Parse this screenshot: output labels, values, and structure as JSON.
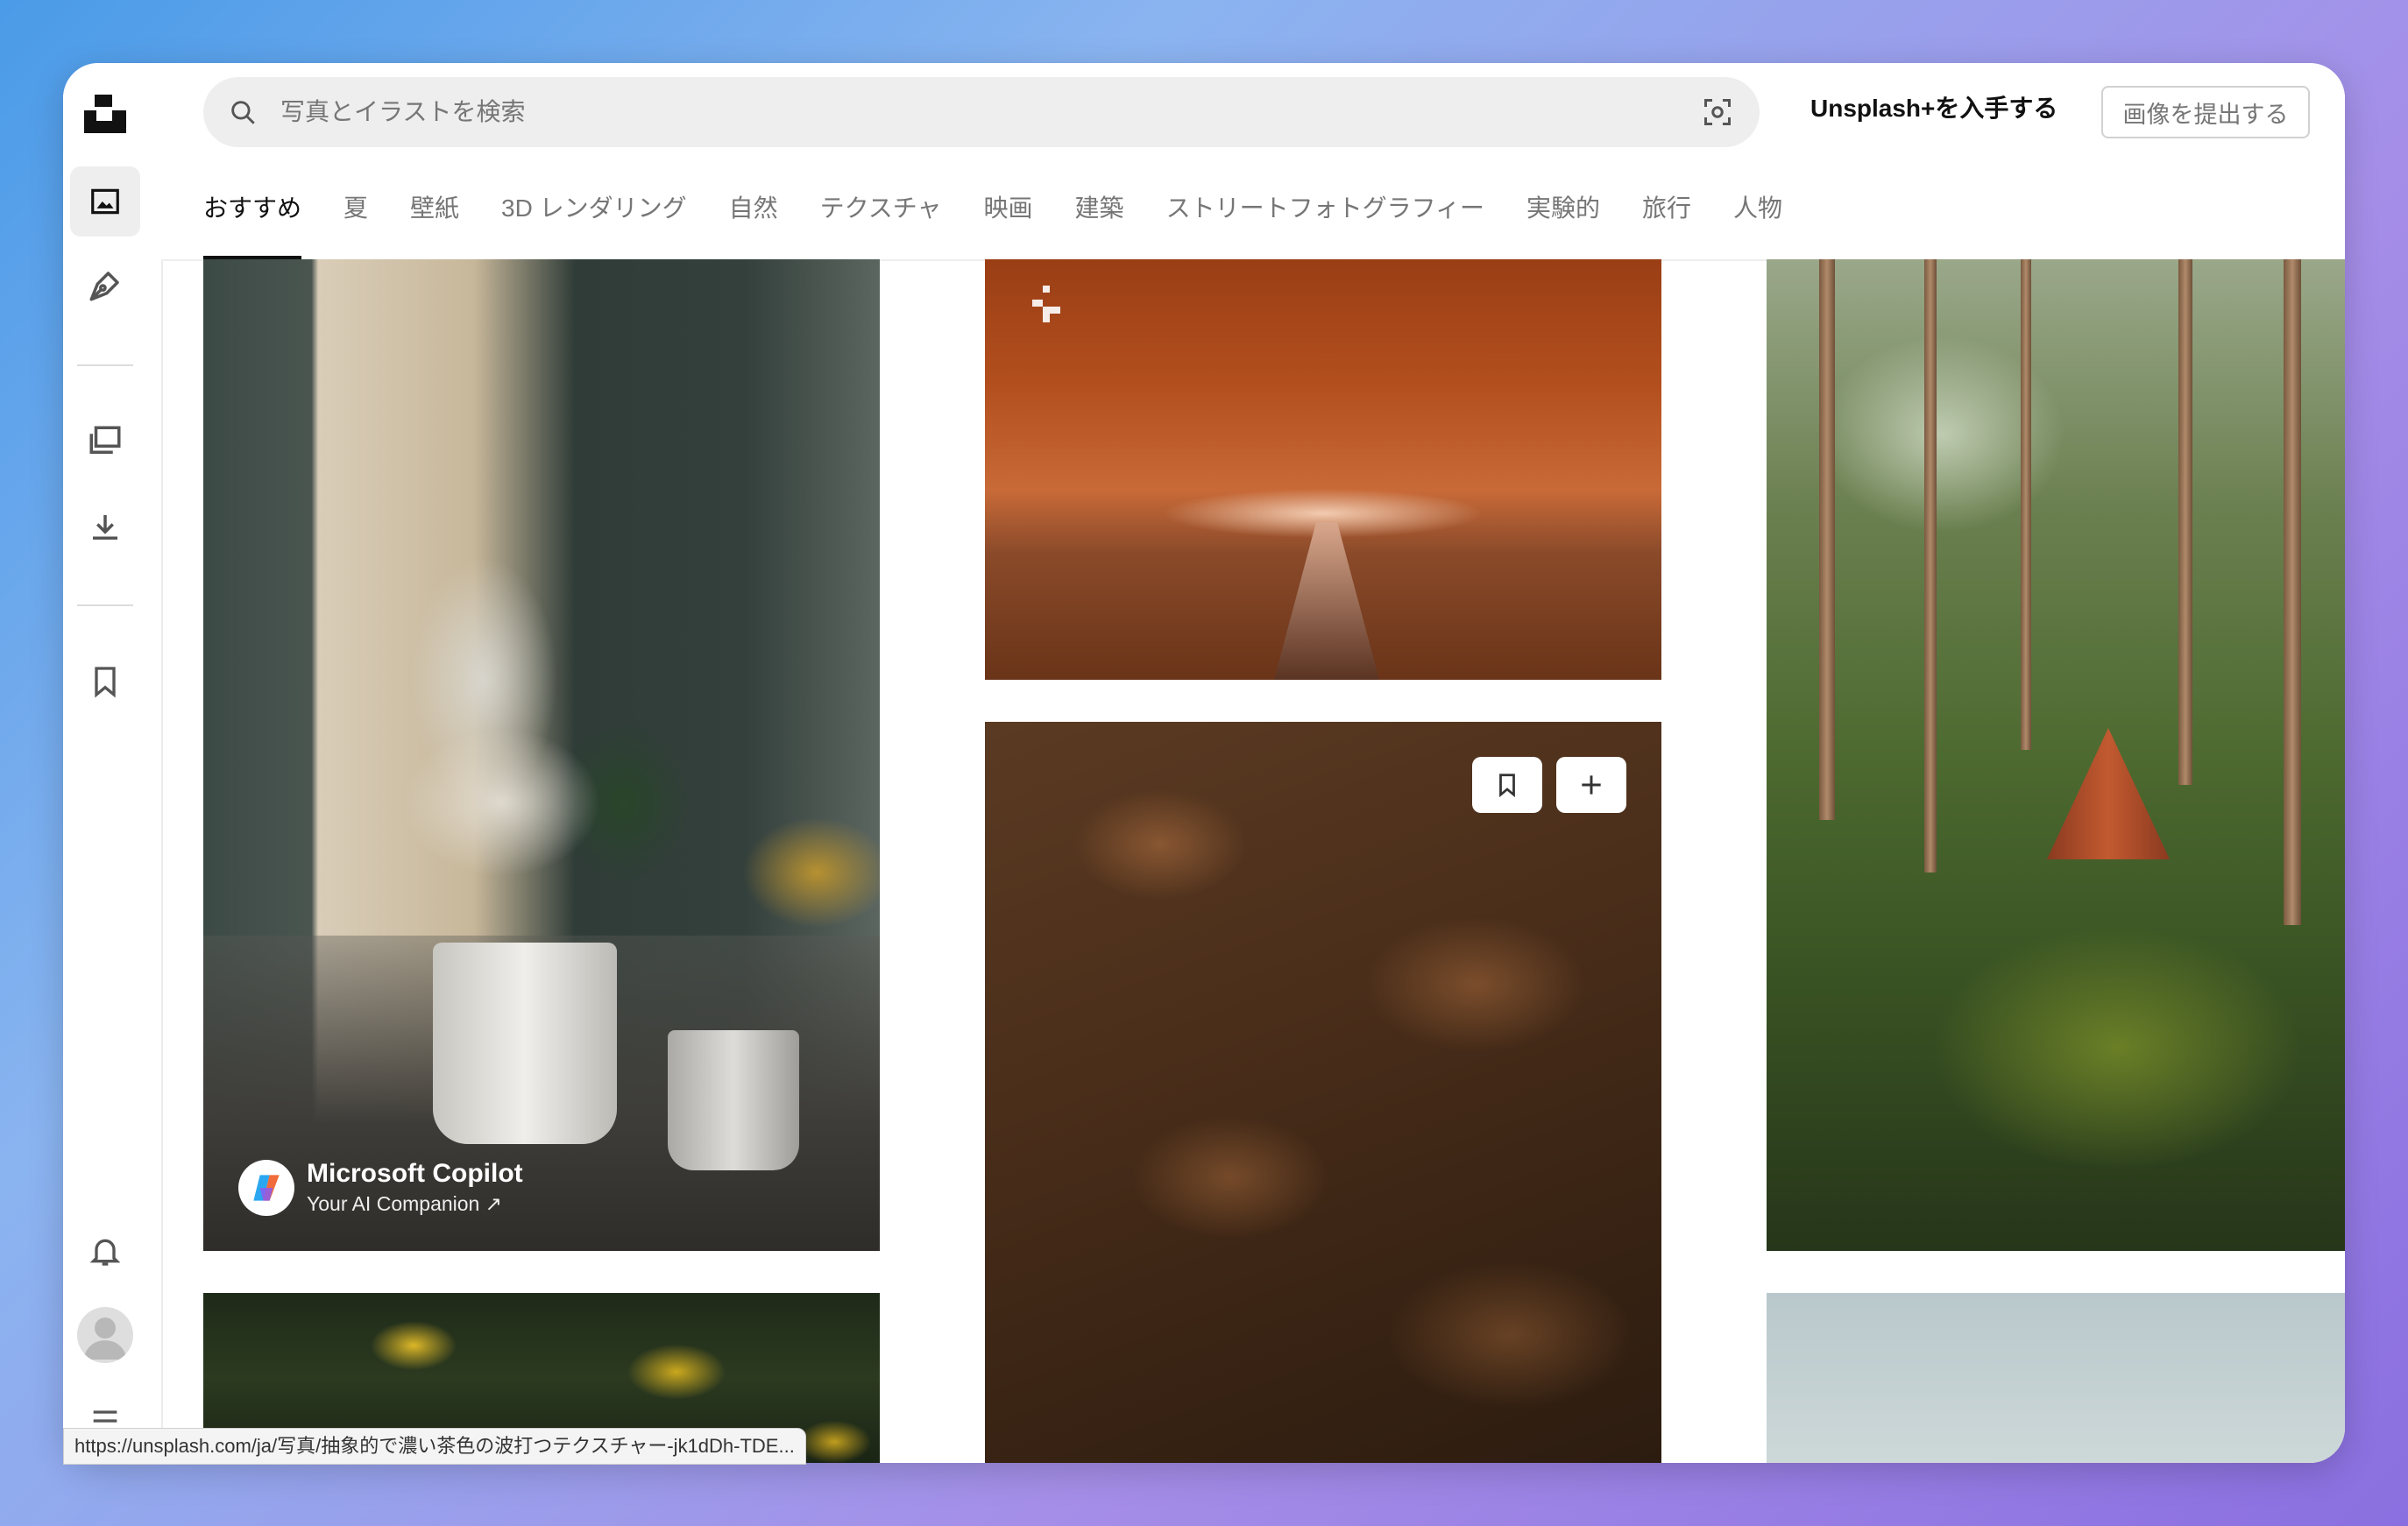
{
  "search": {
    "placeholder": "写真とイラストを検索"
  },
  "header": {
    "plus_label": "Unsplash+を入手する",
    "submit_label": "画像を提出する"
  },
  "tabs": [
    {
      "label": "おすすめ",
      "active": true
    },
    {
      "label": "夏"
    },
    {
      "label": "壁紙"
    },
    {
      "label": "3D レンダリング"
    },
    {
      "label": "自然"
    },
    {
      "label": "テクスチャ"
    },
    {
      "label": "映画"
    },
    {
      "label": "建築"
    },
    {
      "label": "ストリートフォトグラフィー"
    },
    {
      "label": "実験的"
    },
    {
      "label": "旅行"
    },
    {
      "label": "人物"
    }
  ],
  "sidebar": {
    "icons": [
      "unsplash-logo",
      "photos-icon",
      "illustrations-icon",
      "collections-icon",
      "downloads-icon",
      "bookmark-icon",
      "bell-icon",
      "avatar",
      "menu-icon"
    ]
  },
  "sponsor": {
    "name": "Microsoft Copilot",
    "tagline": "Your AI Companion ↗"
  },
  "status_url": "https://unsplash.com/ja/写真/抽象的で濃い茶色の波打つテクスチャー-jk1dDh-TDE..."
}
